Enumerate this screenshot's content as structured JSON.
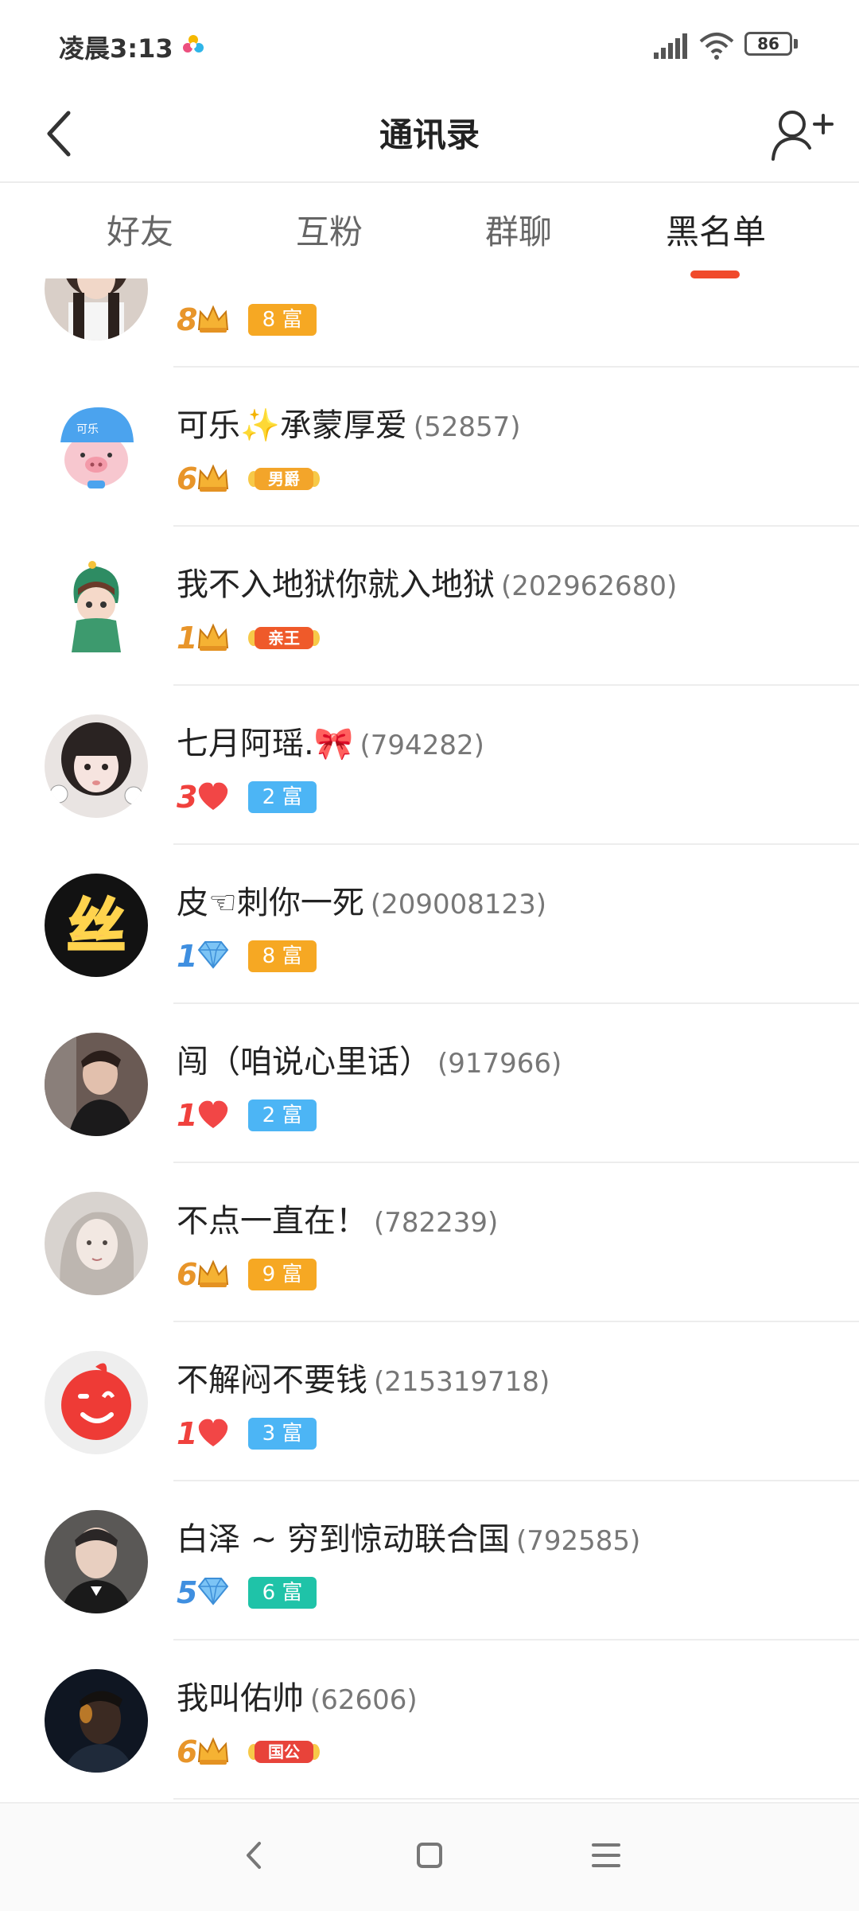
{
  "status_bar": {
    "time": "凌晨3:13",
    "battery": "86"
  },
  "header": {
    "title": "通讯录"
  },
  "tabs": [
    {
      "label": "好友"
    },
    {
      "label": "互粉"
    },
    {
      "label": "群聊"
    },
    {
      "label": "黑名单",
      "active": true
    }
  ],
  "colors": {
    "accent": "#f04a2b",
    "rich_orange": "#f6a823",
    "rich_blue": "#4cb5f5",
    "rich_teal": "#1fc3a8",
    "crown_gold": "#f0a726",
    "heart_red": "#f24b4b",
    "diamond_blue": "#5aaef0"
  },
  "contacts": [
    {
      "name": "",
      "uid": "",
      "level": "8",
      "level_icon": "crown-icon",
      "badge_type": "rich",
      "badge_text": "8 富",
      "badge_color": "#f6a823"
    },
    {
      "name": "可乐✨承蒙厚爱",
      "uid": "(52857)",
      "level": "6",
      "level_icon": "crown-icon",
      "badge_type": "title",
      "badge_text": "男爵",
      "badge_color": "#f3a52a"
    },
    {
      "name": "我不入地狱你就入地狱",
      "uid": "(202962680)",
      "level": "1",
      "level_icon": "crown-icon",
      "badge_type": "title",
      "badge_text": "亲王",
      "badge_color": "#ef5a2a"
    },
    {
      "name": "七月阿瑶.🎀",
      "uid": "(794282)",
      "level": "3",
      "level_icon": "heart-icon",
      "badge_type": "rich",
      "badge_text": "2 富",
      "badge_color": "#4cb5f5"
    },
    {
      "name": "皮☜刺你一死",
      "uid": "(209008123)",
      "level": "1",
      "level_icon": "diamond-icon",
      "badge_type": "rich",
      "badge_text": "8 富",
      "badge_color": "#f6a823"
    },
    {
      "name": "闯（咱说心里话）",
      "uid": "(917966)",
      "level": "1",
      "level_icon": "heart-icon",
      "badge_type": "rich",
      "badge_text": "2 富",
      "badge_color": "#4cb5f5"
    },
    {
      "name": "不点一直在！",
      "uid": "(782239)",
      "level": "6",
      "level_icon": "crown-icon",
      "badge_type": "rich",
      "badge_text": "9 富",
      "badge_color": "#f6a823"
    },
    {
      "name": "不解闷不要钱",
      "uid": "(215319718)",
      "level": "1",
      "level_icon": "heart-icon",
      "badge_type": "rich",
      "badge_text": "3 富",
      "badge_color": "#4cb5f5"
    },
    {
      "name": "白泽 ~ 穷到惊动联合国",
      "uid": "(792585)",
      "level": "5",
      "level_icon": "diamond-icon",
      "badge_type": "rich",
      "badge_text": "6 富",
      "badge_color": "#1fc3a8"
    },
    {
      "name": "我叫佑帅",
      "uid": "(62606)",
      "level": "6",
      "level_icon": "crown-icon",
      "badge_type": "title",
      "badge_text": "国公",
      "badge_color": "#e8433a"
    }
  ]
}
